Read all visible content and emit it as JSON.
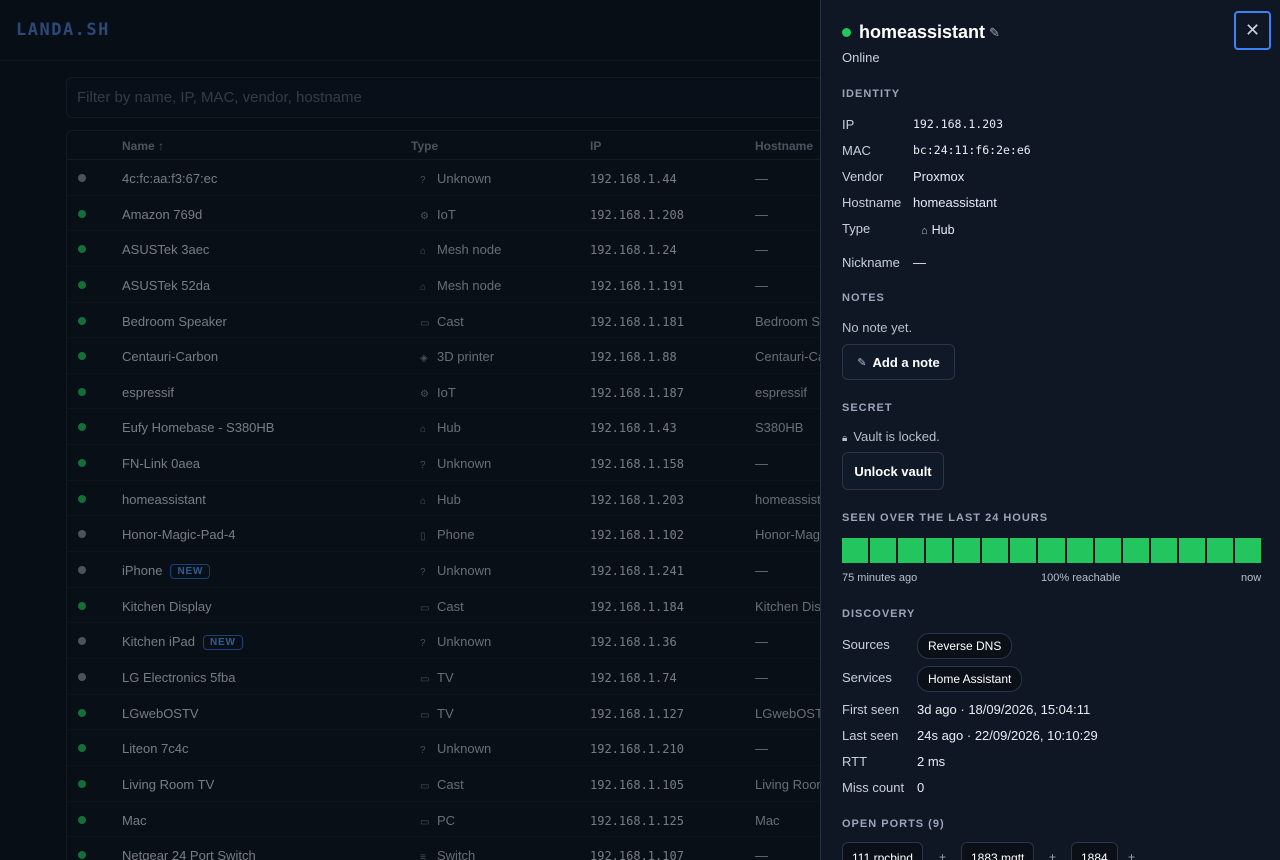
{
  "app": {
    "logo": "LANDA.SH",
    "filter_placeholder": "Filter by name, IP, MAC, vendor, hostname",
    "columns": {
      "name": "Name ↑",
      "type": "Type",
      "ip": "IP",
      "hostname": "Hostname"
    },
    "new_badge": "NEW",
    "rows": [
      {
        "name": "4c:fc:aa:f3:67:ec",
        "type": "Unknown",
        "type_icon": "?",
        "ip": "192.168.1.44",
        "hostname": "—",
        "online": false
      },
      {
        "name": "Amazon 769d",
        "type": "IoT",
        "type_icon": "⚙",
        "ip": "192.168.1.208",
        "hostname": "—",
        "online": true
      },
      {
        "name": "ASUSTek 3aec",
        "type": "Mesh node",
        "type_icon": "⌂",
        "ip": "192.168.1.24",
        "hostname": "—",
        "online": true
      },
      {
        "name": "ASUSTek 52da",
        "type": "Mesh node",
        "type_icon": "⌂",
        "ip": "192.168.1.191",
        "hostname": "—",
        "online": true
      },
      {
        "name": "Bedroom Speaker",
        "type": "Cast",
        "type_icon": "▭",
        "ip": "192.168.1.181",
        "hostname": "Bedroom Sp",
        "online": true
      },
      {
        "name": "Centauri-Carbon",
        "type": "3D printer",
        "type_icon": "◈",
        "ip": "192.168.1.88",
        "hostname": "Centauri-Car",
        "online": true
      },
      {
        "name": "espressif",
        "type": "IoT",
        "type_icon": "⚙",
        "ip": "192.168.1.187",
        "hostname": "espressif",
        "online": true
      },
      {
        "name": "Eufy Homebase - S380HB",
        "type": "Hub",
        "type_icon": "⌂",
        "ip": "192.168.1.43",
        "hostname": "S380HB",
        "online": true
      },
      {
        "name": "FN-Link 0aea",
        "type": "Unknown",
        "type_icon": "?",
        "ip": "192.168.1.158",
        "hostname": "—",
        "online": true
      },
      {
        "name": "homeassistant",
        "type": "Hub",
        "type_icon": "⌂",
        "ip": "192.168.1.203",
        "hostname": "homeassista",
        "online": true
      },
      {
        "name": "Honor-Magic-Pad-4",
        "type": "Phone",
        "type_icon": "▯",
        "ip": "192.168.1.102",
        "hostname": "Honor-Magi",
        "online": false
      },
      {
        "name": "iPhone",
        "type": "Unknown",
        "type_icon": "?",
        "ip": "192.168.1.241",
        "hostname": "—",
        "online": false,
        "new": true
      },
      {
        "name": "Kitchen Display",
        "type": "Cast",
        "type_icon": "▭",
        "ip": "192.168.1.184",
        "hostname": "Kitchen Disp",
        "online": true
      },
      {
        "name": "Kitchen iPad",
        "type": "Unknown",
        "type_icon": "?",
        "ip": "192.168.1.36",
        "hostname": "—",
        "online": false,
        "new": true
      },
      {
        "name": "LG Electronics 5fba",
        "type": "TV",
        "type_icon": "▭",
        "ip": "192.168.1.74",
        "hostname": "—",
        "online": false
      },
      {
        "name": "LGwebOSTV",
        "type": "TV",
        "type_icon": "▭",
        "ip": "192.168.1.127",
        "hostname": "LGwebOSTV",
        "online": true
      },
      {
        "name": "Liteon 7c4c",
        "type": "Unknown",
        "type_icon": "?",
        "ip": "192.168.1.210",
        "hostname": "—",
        "online": true
      },
      {
        "name": "Living Room TV",
        "type": "Cast",
        "type_icon": "▭",
        "ip": "192.168.1.105",
        "hostname": "Living Room",
        "online": true
      },
      {
        "name": "Mac",
        "type": "PC",
        "type_icon": "▭",
        "ip": "192.168.1.125",
        "hostname": "Mac",
        "online": true
      },
      {
        "name": "Netgear 24 Port Switch",
        "type": "Switch",
        "type_icon": "≡",
        "ip": "192.168.1.107",
        "hostname": "—",
        "online": true
      }
    ]
  },
  "drawer": {
    "title": "homeassistant",
    "status": "Online",
    "sections": {
      "identity": "IDENTITY",
      "notes": "NOTES",
      "secret": "SECRET",
      "seen": "SEEN OVER THE LAST 24 HOURS",
      "discovery": "DISCOVERY",
      "ports": "OPEN PORTS (9)"
    },
    "identity": {
      "ip_label": "IP",
      "ip": "192.168.1.203",
      "mac_label": "MAC",
      "mac": "bc:24:11:f6:2e:e6",
      "vendor_label": "Vendor",
      "vendor": "Proxmox",
      "hostname_label": "Hostname",
      "hostname": "homeassistant",
      "type_label": "Type",
      "type": "Hub",
      "nickname_label": "Nickname",
      "nickname": "—"
    },
    "notes": {
      "empty": "No note yet.",
      "add_button": "Add a note"
    },
    "secret": {
      "locked": "Vault is locked.",
      "unlock_button": "Unlock vault"
    },
    "seen": {
      "start": "75 minutes ago",
      "middle": "100% reachable",
      "end": "now",
      "reachable_fraction": 1.0,
      "segments": 15,
      "color": "#22c55e"
    },
    "discovery": {
      "sources_label": "Sources",
      "sources": "Reverse DNS",
      "services_label": "Services",
      "services": "Home Assistant",
      "first_seen_label": "First seen",
      "first_seen": "3d ago · 18/09/2026, 15:04:11",
      "last_seen_label": "Last seen",
      "last_seen": "24s ago · 22/09/2026, 10:10:29",
      "rtt_label": "RTT",
      "rtt": "2 ms",
      "miss_label": "Miss count",
      "miss": "0"
    },
    "ports": [
      {
        "label": "111 rpcbind"
      },
      {
        "label": "1883 mqtt"
      },
      {
        "label": "1884"
      }
    ]
  }
}
